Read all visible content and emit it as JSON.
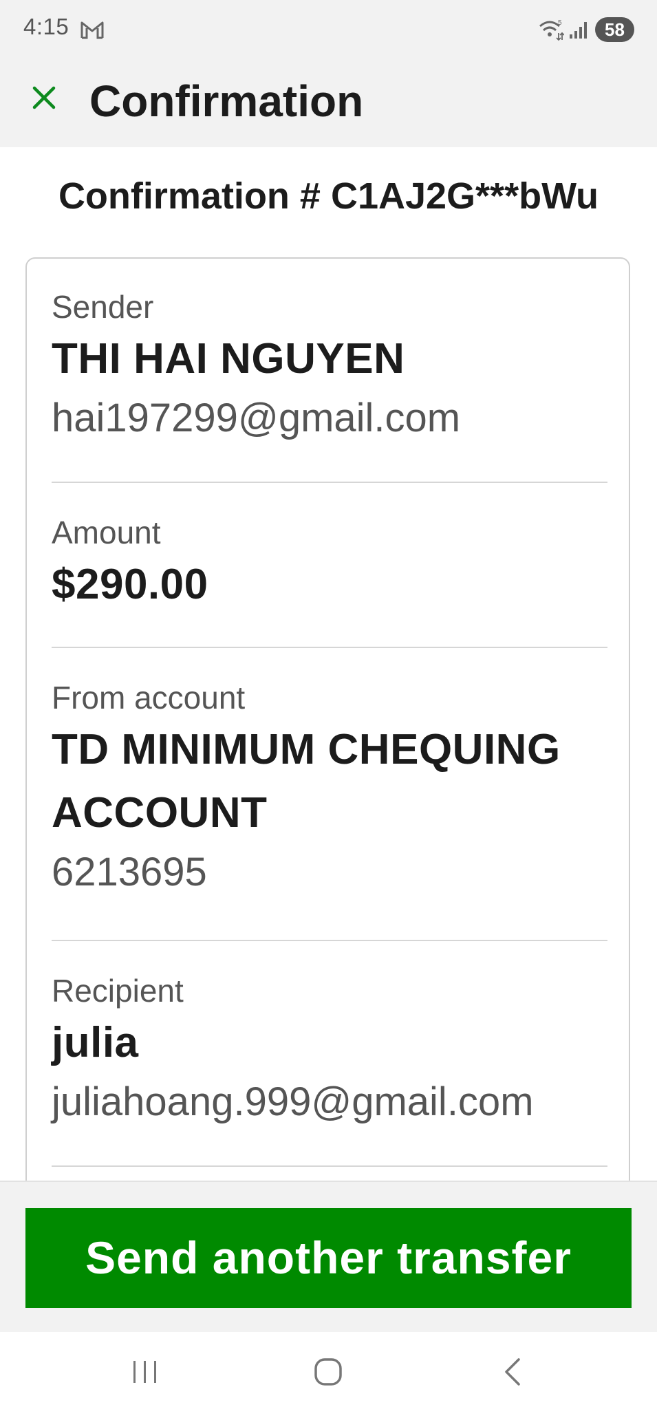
{
  "status_bar": {
    "time": "4:15",
    "battery": "58",
    "icons": [
      "gmail-icon",
      "wifi-icon",
      "signal-icon"
    ]
  },
  "header": {
    "title": "Confirmation",
    "close_icon": "close-icon"
  },
  "confirmation": {
    "number_text": "Confirmation # C1AJ2G***bWu"
  },
  "details": {
    "sender": {
      "label": "Sender",
      "name": "THI HAI NGUYEN",
      "email": "hai197299@gmail.com"
    },
    "amount": {
      "label": "Amount",
      "value": "$290.00"
    },
    "from_account": {
      "label": "From account",
      "name_line1": "TD MINIMUM CHEQUING",
      "name_line2": "ACCOUNT",
      "number": "6213695"
    },
    "recipient": {
      "label": "Recipient",
      "name": "julia",
      "email": "juliahoang.999@gmail.com"
    }
  },
  "actions": {
    "send_another": "Send another transfer"
  },
  "colors": {
    "accent": "#008a00",
    "background": "#f2f2f2",
    "card_border": "#cfcfcf"
  },
  "nav": {
    "icons": [
      "recents-icon",
      "home-icon",
      "back-icon"
    ]
  }
}
